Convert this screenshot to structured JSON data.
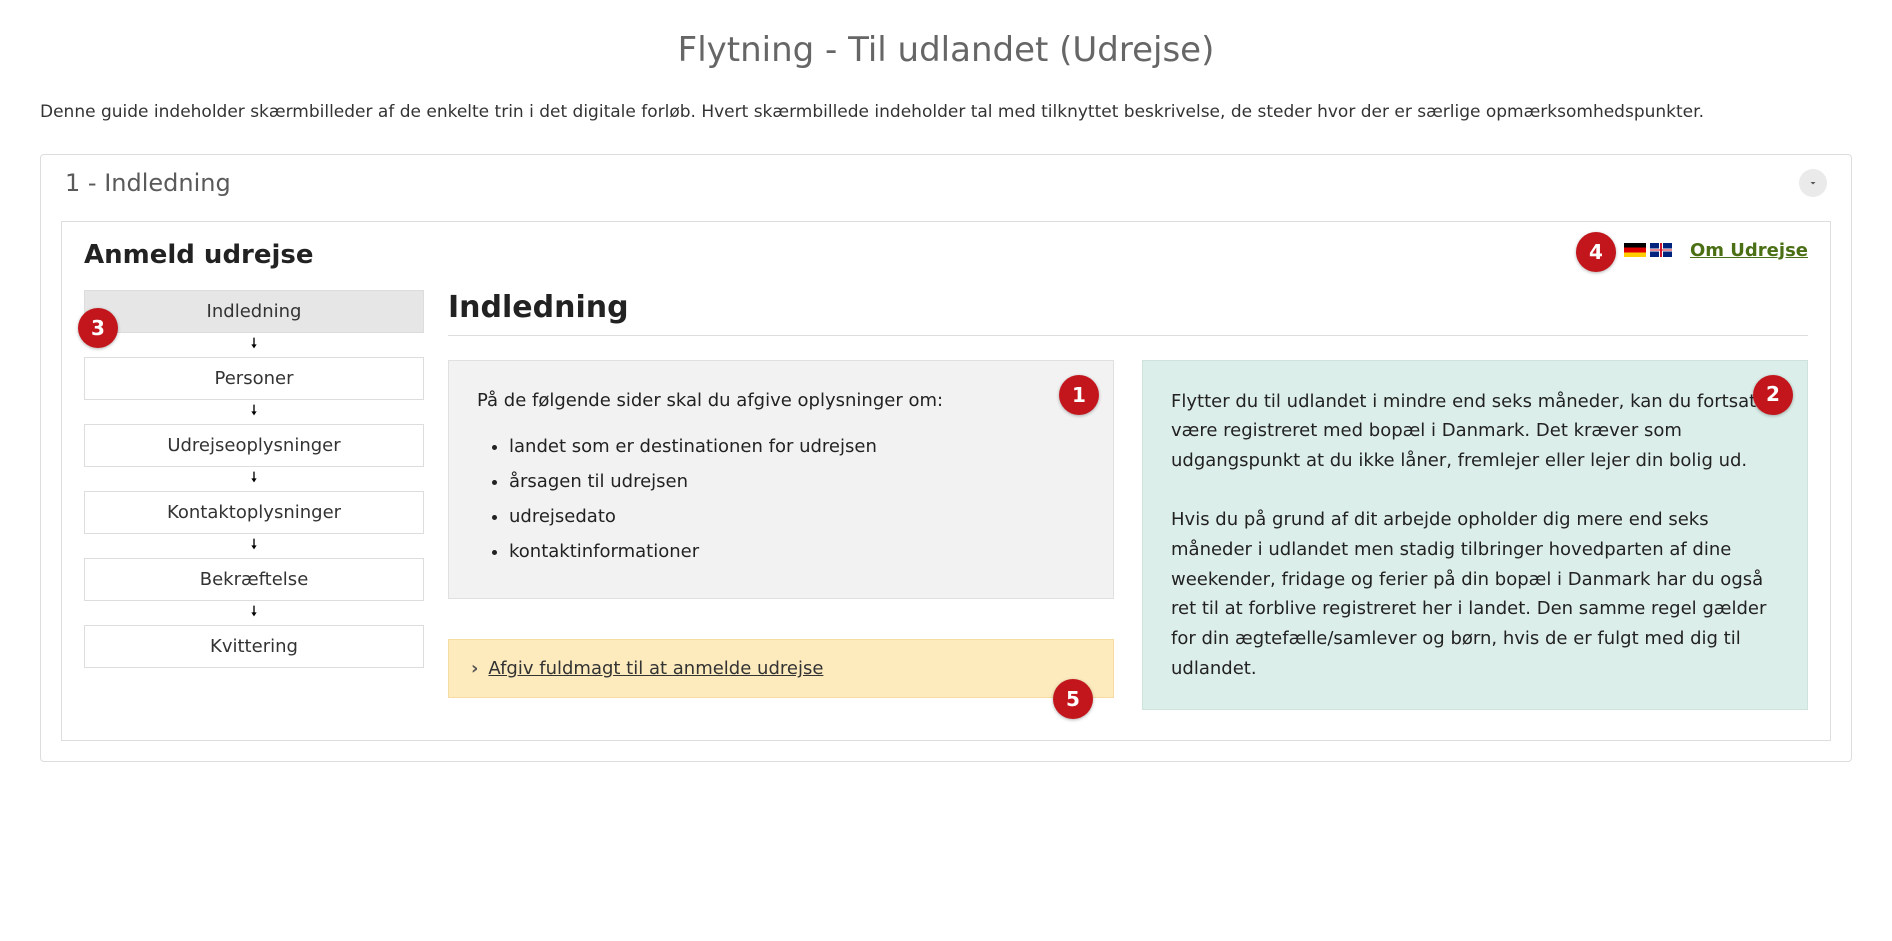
{
  "page_title": "Flytning - Til udlandet (Udrejse)",
  "intro": "Denne guide indeholder skærmbilleder af de enkelte trin i det digitale forløb. Hvert skærmbillede indeholder tal med tilknyttet beskrivelse, de steder hvor der er særlige opmærksomhedspunkter.",
  "panel_title": "1 - Indledning",
  "inner": {
    "title": "Anmeld udrejse",
    "om_link": "Om Udrejse",
    "flags": {
      "de": "German",
      "gb": "English"
    },
    "steps": [
      "Indledning",
      "Personer",
      "Udrejseoplysninger",
      "Kontaktoplysninger",
      "Bekræftelse",
      "Kvittering"
    ],
    "main_heading": "Indledning",
    "grey_intro": "På de følgende sider skal du afgive oplysninger om:",
    "grey_bullets": [
      "landet som er destinationen for udrejsen",
      "årsagen til udrejsen",
      "udrejsedato",
      "kontaktinformationer"
    ],
    "teal_p1": "Flytter du til udlandet i mindre end seks måneder, kan du fortsat være registreret med bopæl i Danmark. Det kræver som udgangspunkt at du ikke låner, fremlejer eller lejer din bolig ud.",
    "teal_p2": "Hvis du på grund af dit arbejde opholder dig mere end seks måneder i udlandet men stadig tilbringer hovedparten af dine weekender, fridage og ferier på din bopæl i Danmark har du også ret til at forblive registreret her i landet. Den samme regel gælder for din ægtefælle/samlever og børn, hvis de er fulgt med dig til udlandet.",
    "yellow_link": "Afgiv fuldmagt til at anmelde udrejse"
  },
  "bubbles": {
    "n1": "1",
    "n2": "2",
    "n3": "3",
    "n4": "4",
    "n5": "5"
  }
}
